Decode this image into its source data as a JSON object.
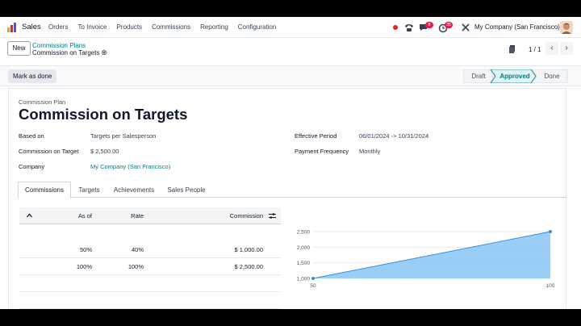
{
  "navbar": {
    "brand": "Sales",
    "menu": [
      "Orders",
      "To Invoice",
      "Products",
      "Commissions",
      "Reporting",
      "Configuration"
    ],
    "badge_messages": "8",
    "badge_activities": "35",
    "company": "My Company (San Francisco)"
  },
  "control": {
    "new_label": "New",
    "breadcrumb_parent": "Commission Plans",
    "breadcrumb_current": "Commission on Targets",
    "pager": "1 / 1"
  },
  "statusbar": {
    "mark_done": "Mark as done",
    "stages": [
      "Draft",
      "Approved",
      "Done"
    ],
    "active_stage": "Approved"
  },
  "form": {
    "plan_label": "Commission Plan",
    "title": "Commission on Targets",
    "based_on_label": "Based on",
    "based_on": "Targets per Salesperson",
    "commission_target_label": "Commission on Target",
    "commission_target": "$ 2,500.00",
    "company_label": "Company",
    "company": "My Company (San Francisco)",
    "effective_period_label": "Effective Period",
    "effective_period": "06/01/2024 -> 10/31/2024",
    "payment_frequency_label": "Payment Frequency",
    "payment_frequency": "Monthly"
  },
  "tabs": [
    "Commissions",
    "Targets",
    "Achievements",
    "Sales People"
  ],
  "table": {
    "headers": {
      "as_of": "As of",
      "rate": "Rate",
      "commission": "Commission"
    },
    "rows": [
      {
        "as_of": "50%",
        "rate": "40%",
        "commission": "$ 1,000.00"
      },
      {
        "as_of": "100%",
        "rate": "100%",
        "commission": "$ 2,500.00"
      }
    ]
  },
  "colors": {
    "accent": "#017e84",
    "primary": "#714b67",
    "chart_fill": "#90c9f5",
    "chart_line": "#3b8fd9"
  },
  "chart_data": {
    "type": "area",
    "x": [
      50,
      100
    ],
    "values": [
      1000,
      2500
    ],
    "x_ticks": [
      "50",
      "100"
    ],
    "y_ticks": [
      "1,000",
      "1,500",
      "2,000",
      "2,500"
    ],
    "xlim": [
      50,
      100
    ],
    "ylim": [
      1000,
      2500
    ],
    "grid": true
  }
}
